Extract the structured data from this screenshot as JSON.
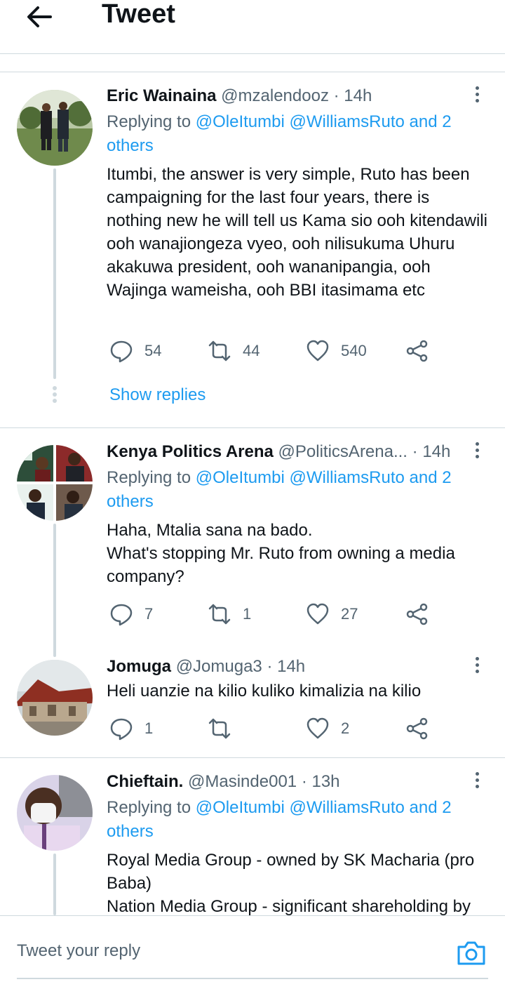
{
  "header": {
    "title": "Tweet",
    "back_icon": "arrow-left-icon"
  },
  "tweets": [
    {
      "name": "Eric Wainaina",
      "handle": "@mzalendooz",
      "time": "· 14h",
      "replying_label": "Replying to ",
      "replying_links": "@OleItumbi @WilliamsRuto and 2 others",
      "text": "Itumbi, the answer is very simple, Ruto has been campaigning for the last four years, there is nothing new he will tell us Kama sio ooh kitendawili ooh wanajiongeza vyeo, ooh nilisukuma Uhuru akakuwa president, ooh wananipangia, ooh Wajinga wameisha, ooh BBI itasimama etc",
      "replies": "54",
      "retweets": "44",
      "likes": "540"
    },
    {
      "name": "Kenya Politics Arena",
      "handle": "@PoliticsArena...",
      "time": "· 14h",
      "replying_label": "Replying to ",
      "replying_links": "@OleItumbi @WilliamsRuto and 2 others",
      "text": "Haha, Mtalia sana na bado.\nWhat's stopping Mr. Ruto from owning a media company?",
      "replies": "7",
      "retweets": "1",
      "likes": "27"
    },
    {
      "name": "Jomuga",
      "handle": "@Jomuga3",
      "time": "· 14h",
      "text": "Heli uanzie na kilio kuliko kimalizia na kilio",
      "replies": "1",
      "retweets": "",
      "likes": "2"
    },
    {
      "name": "Chieftain.",
      "handle": "@Masinde001",
      "time": "· 13h",
      "replying_label": "Replying to ",
      "replying_links": "@OleItumbi @WilliamsRuto and 2 others",
      "text": "Royal Media Group - owned by SK Macharia (pro Baba)\nNation Media Group - significant shareholding by"
    }
  ],
  "show_replies": "Show replies",
  "composer": {
    "placeholder": "Tweet your reply",
    "camera_icon": "camera-icon"
  },
  "colors": {
    "accent": "#1d9bf0",
    "text": "#0f1419",
    "muted": "#536471",
    "divider": "#cfd9de"
  }
}
